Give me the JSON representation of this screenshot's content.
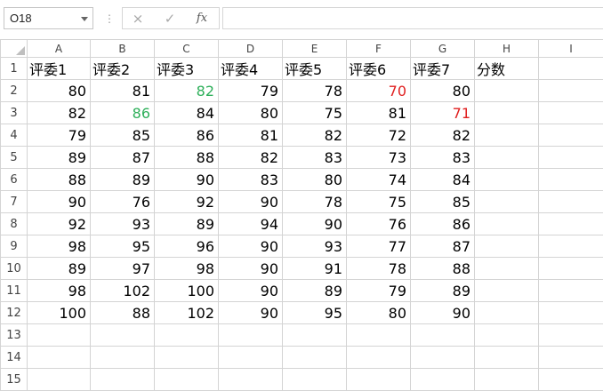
{
  "formula_bar": {
    "name_box": "O18",
    "separator": "⋮",
    "cancel_icon": "×",
    "enter_icon": "✓",
    "fx_label": "fx",
    "formula": ""
  },
  "columns": [
    "A",
    "B",
    "C",
    "D",
    "E",
    "F",
    "G",
    "H",
    "I"
  ],
  "row_numbers": [
    "1",
    "2",
    "3",
    "4",
    "5",
    "6",
    "7",
    "8",
    "9",
    "10",
    "11",
    "12",
    "13",
    "14",
    "15"
  ],
  "headers": [
    "评委1",
    "评委2",
    "评委3",
    "评委4",
    "评委5",
    "评委6",
    "评委7",
    "分数",
    ""
  ],
  "rows": [
    [
      "80",
      "81",
      "82",
      "79",
      "78",
      "70",
      "80",
      "",
      ""
    ],
    [
      "82",
      "86",
      "84",
      "80",
      "75",
      "81",
      "71",
      "",
      ""
    ],
    [
      "79",
      "85",
      "86",
      "81",
      "82",
      "72",
      "82",
      "",
      ""
    ],
    [
      "89",
      "87",
      "88",
      "82",
      "83",
      "73",
      "83",
      "",
      ""
    ],
    [
      "88",
      "89",
      "90",
      "83",
      "80",
      "74",
      "84",
      "",
      ""
    ],
    [
      "90",
      "76",
      "92",
      "90",
      "78",
      "75",
      "85",
      "",
      ""
    ],
    [
      "92",
      "93",
      "89",
      "94",
      "90",
      "76",
      "86",
      "",
      ""
    ],
    [
      "98",
      "95",
      "96",
      "90",
      "93",
      "77",
      "87",
      "",
      ""
    ],
    [
      "89",
      "97",
      "98",
      "90",
      "91",
      "78",
      "88",
      "",
      ""
    ],
    [
      "98",
      "102",
      "100",
      "90",
      "89",
      "79",
      "89",
      "",
      ""
    ],
    [
      "100",
      "88",
      "102",
      "90",
      "95",
      "80",
      "90",
      "",
      ""
    ],
    [
      "",
      "",
      "",
      "",
      "",
      "",
      "",
      "",
      ""
    ],
    [
      "",
      "",
      "",
      "",
      "",
      "",
      "",
      "",
      ""
    ],
    [
      "",
      "",
      "",
      "",
      "",
      "",
      "",
      "",
      ""
    ]
  ],
  "highlights": {
    "green": "#2eaf5a",
    "red": "#e02020",
    "green_cells": [
      "C2",
      "B3"
    ],
    "red_cells": [
      "F2",
      "G3"
    ]
  }
}
